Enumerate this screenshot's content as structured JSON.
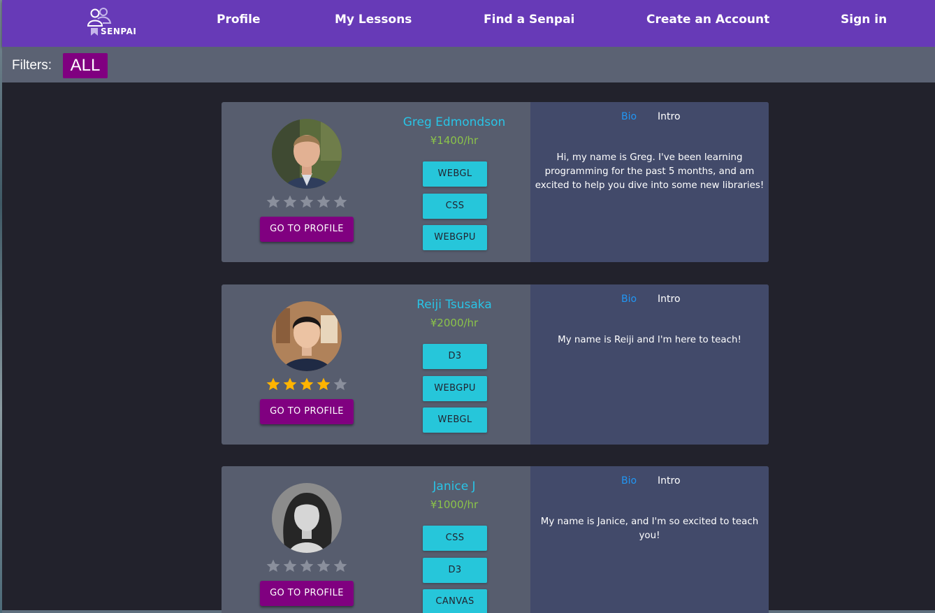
{
  "nav": {
    "logo_text": "SENPAI",
    "items": [
      "Profile",
      "My Lessons",
      "Find a Senpai",
      "Create an Account",
      "Sign in"
    ]
  },
  "filters": {
    "label": "Filters:",
    "selected": "ALL"
  },
  "colors": {
    "navbar": "#673ab7",
    "primary_button": "#800080",
    "tag": "#26c6da",
    "name": "#29c4e6",
    "price": "#8bc34a",
    "star_filled": "#ffb400",
    "star_empty": "#8a8f9c",
    "active_tab": "#2196f3"
  },
  "tutors": [
    {
      "name": "Greg Edmondson",
      "price": "¥1400/hr",
      "rating": 0,
      "tags": [
        "WEBGL",
        "CSS",
        "WEBGPU"
      ],
      "button_label": "GO TO PROFILE",
      "tabs": [
        "Bio",
        "Intro"
      ],
      "bio": "Hi, my name is Greg. I've been learning programming for the past 5 months, and am excited to help you dive into some new libraries!"
    },
    {
      "name": "Reiji Tsusaka",
      "price": "¥2000/hr",
      "rating": 4,
      "tags": [
        "D3",
        "WEBGPU",
        "WEBGL"
      ],
      "button_label": "GO TO PROFILE",
      "tabs": [
        "Bio",
        "Intro"
      ],
      "bio": "My name is Reiji and I'm here to teach!"
    },
    {
      "name": "Janice J",
      "price": "¥1000/hr",
      "rating": 0,
      "tags": [
        "CSS",
        "D3",
        "CANVAS"
      ],
      "button_label": "GO TO PROFILE",
      "tabs": [
        "Bio",
        "Intro"
      ],
      "bio": "My name is Janice, and I'm so excited to teach you!"
    }
  ]
}
